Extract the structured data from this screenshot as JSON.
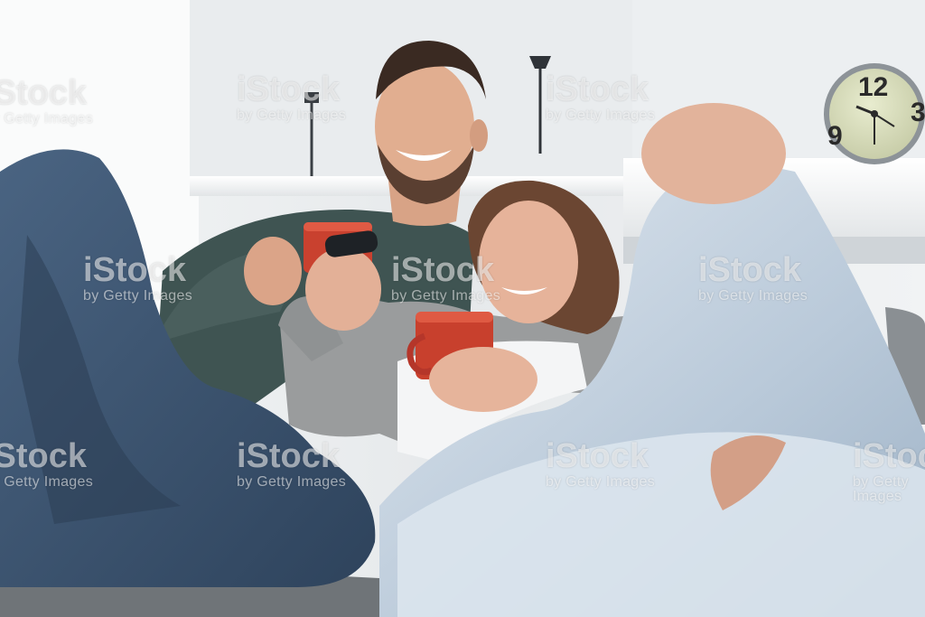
{
  "image": {
    "watermark": {
      "brand": "iStock",
      "credit": "by Getty Images"
    },
    "clock": {
      "numerals": [
        "12",
        "9",
        "3"
      ]
    }
  }
}
